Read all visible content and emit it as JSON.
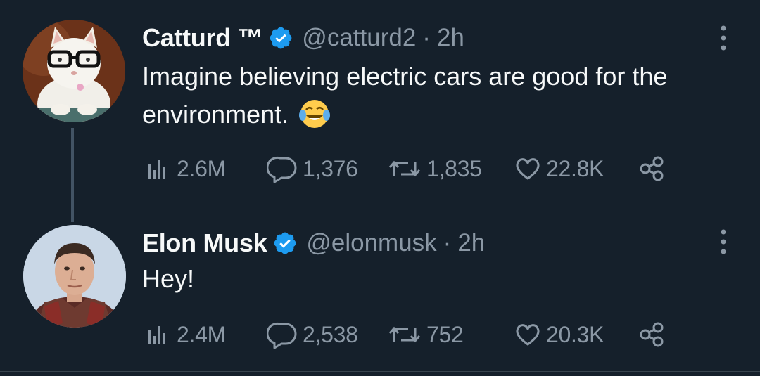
{
  "tweets": [
    {
      "display_name": "Catturd ™",
      "handle": "@catturd2",
      "separator": "·",
      "timestamp": "2h",
      "text": "Imagine believing electric cars are good for the environment.",
      "emoji": "😂",
      "stats": {
        "views": "2.6M",
        "replies": "1,376",
        "retweets": "1,835",
        "likes": "22.8K"
      }
    },
    {
      "display_name": "Elon Musk",
      "handle": "@elonmusk",
      "separator": "·",
      "timestamp": "2h",
      "text": "Hey!",
      "stats": {
        "views": "2.4M",
        "replies": "2,538",
        "retweets": "752",
        "likes": "20.3K"
      }
    }
  ],
  "icons": {
    "verified": "verified-badge-icon",
    "more": "more-options-icon",
    "views": "analytics-icon",
    "reply": "reply-icon",
    "retweet": "retweet-icon",
    "like": "heart-icon",
    "share": "share-icon"
  },
  "colors": {
    "background": "#15202b",
    "primary_text": "#f7f9f9",
    "secondary_text": "#8b98a5",
    "verified_blue": "#1d9bf0",
    "thread_line": "#425364"
  }
}
